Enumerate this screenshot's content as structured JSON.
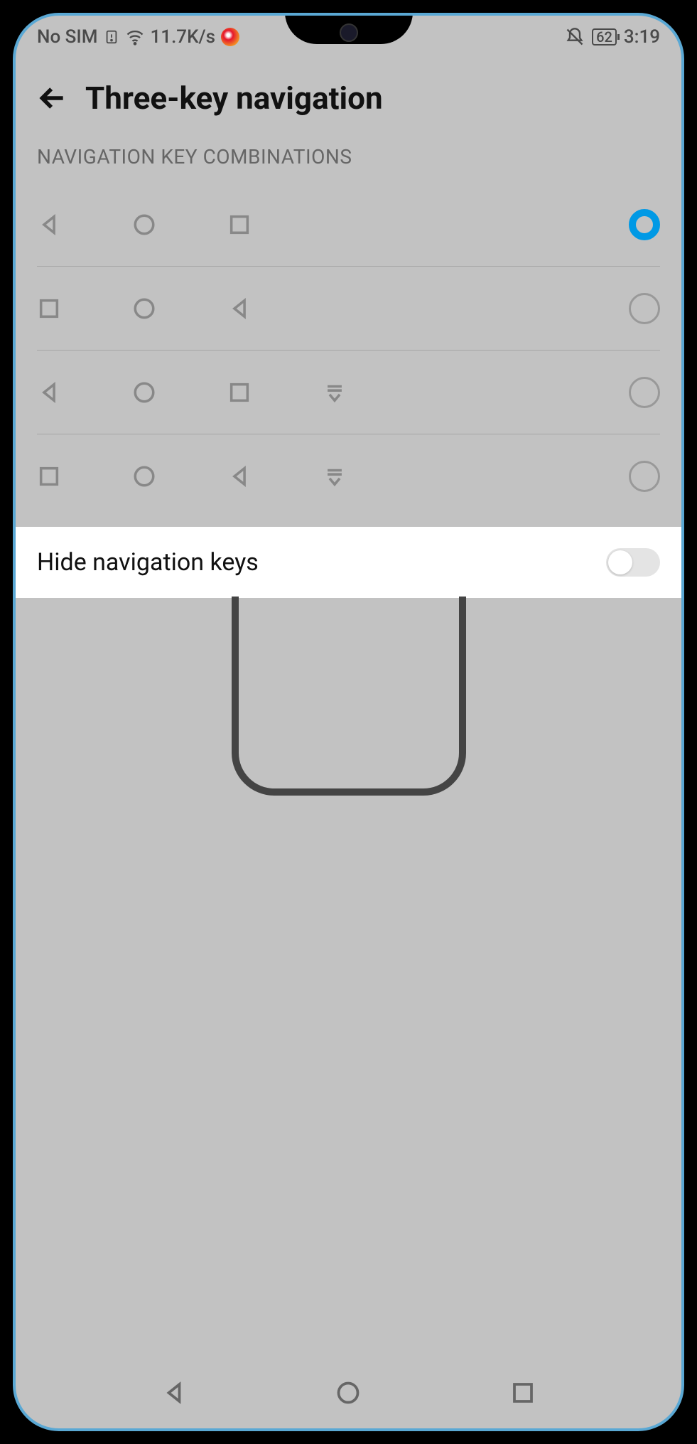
{
  "status": {
    "sim": "No SIM",
    "speed": "11.7K/s",
    "battery": "62",
    "time": "3:19"
  },
  "header": {
    "title": "Three-key navigation"
  },
  "section": {
    "label": "NAVIGATION KEY COMBINATIONS"
  },
  "navRows": [
    {
      "layout": [
        "back",
        "home",
        "recent"
      ],
      "hasDown": false,
      "selected": true
    },
    {
      "layout": [
        "recent",
        "home",
        "back"
      ],
      "hasDown": false,
      "selected": false
    },
    {
      "layout": [
        "back",
        "home",
        "recent"
      ],
      "hasDown": true,
      "selected": false
    },
    {
      "layout": [
        "recent",
        "home",
        "back"
      ],
      "hasDown": true,
      "selected": false
    }
  ],
  "hideRow": {
    "label": "Hide navigation keys",
    "on": false
  }
}
